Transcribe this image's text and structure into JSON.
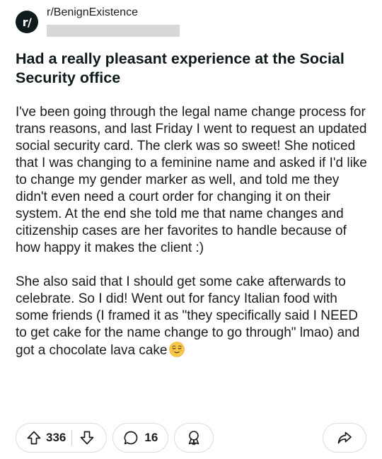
{
  "post": {
    "subreddit": "r/BenignExistence",
    "avatar_text": "r/",
    "title": "Had a really pleasant experience at the Social Security office",
    "paragraphs": [
      "I've been going through the legal name change process for trans reasons, and last Friday I went to request an updated social security card. The clerk was so sweet! She noticed that I was changing to a feminine name and asked if I'd like to change my gender marker as well, and told me they didn't even need a court order for changing it on their system. At the end she told me that name changes and citizenship cases are her favorites to handle because of how happy it makes the client :)",
      "She also said that I should get some cake afterwards to celebrate. So I did! Went out for fancy Italian food with some friends (I framed it as \"they specifically said I NEED to get cake for the name change to go through\" lmao) and got a chocolate lava cake"
    ],
    "emoji": "relieved-face-emoji"
  },
  "actions": {
    "upvotes": "336",
    "comments": "16",
    "icons": {
      "upvote": "upvote-arrow-icon",
      "downvote": "downvote-arrow-icon",
      "comment": "comment-bubble-icon",
      "award": "award-icon",
      "share": "share-arrow-icon"
    }
  },
  "colors": {
    "text": "#1c1c1c",
    "border": "#dcdcdc",
    "redaction": "#d7d7d7",
    "avatar_bg": "#0f1a1c"
  }
}
